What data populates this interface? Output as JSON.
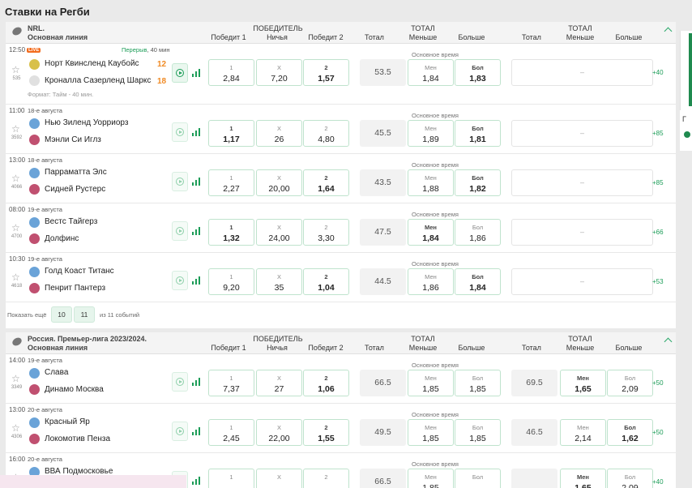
{
  "page": {
    "title": "Ставки на Регби"
  },
  "headers": {
    "winner": "ПОБЕДИТЕЛЬ",
    "win1": "Победит 1",
    "draw": "Ничья",
    "win2": "Победит 2",
    "total": "Тотал",
    "total_caps": "ТОТАЛ",
    "under": "Меньше",
    "over": "Больше",
    "main_time": "Основное время",
    "under_short": "Мен",
    "over_short": "Бол",
    "draw_short": "X",
    "one": "1",
    "two": "2",
    "dash": "–"
  },
  "nrl": {
    "league_name": "NRL.",
    "line": "Основная линия",
    "live_match": {
      "time": "12:50",
      "live_badge": "LIVE",
      "status_main": "Перерыв",
      "status_rest": ", 40 мин",
      "id": "535",
      "team1": "Норт Квинсленд Каубойс",
      "team2": "Кроналла Сазерленд Шаркс",
      "score1": "12",
      "score2": "18",
      "format": "Формат: Тайм - 40 мин.",
      "odds": [
        "2,84",
        "7,20",
        "1,57"
      ],
      "total": "53.5",
      "under": "1,84",
      "over": "1,83",
      "more": "+40"
    },
    "matches": [
      {
        "time": "11:00",
        "date": "18-е августа",
        "id": "3592",
        "team1": "Нью Зиленд Уорриорз",
        "team2": "Мэнли Си Иглз",
        "odds": [
          "1,17",
          "26",
          "4,80"
        ],
        "total": "45.5",
        "under": "1,89",
        "over": "1,81",
        "more": "+85"
      },
      {
        "time": "13:00",
        "date": "18-е августа",
        "id": "4066",
        "team1": "Парраматта Элс",
        "team2": "Сидней Рустерс",
        "odds": [
          "2,27",
          "20,00",
          "1,64"
        ],
        "total": "43.5",
        "under": "1,88",
        "over": "1,82",
        "more": "+85"
      },
      {
        "time": "08:00",
        "date": "19-е августа",
        "id": "4700",
        "team1": "Вестс Тайгерз",
        "team2": "Долфинс",
        "odds": [
          "1,32",
          "24,00",
          "3,30"
        ],
        "total": "47.5",
        "under": "1,84",
        "over": "1,86",
        "more": "+66"
      },
      {
        "time": "10:30",
        "date": "19-е августа",
        "id": "4618",
        "team1": "Голд Коаст Титанс",
        "team2": "Пенрит Пантерз",
        "odds": [
          "9,20",
          "35",
          "1,04"
        ],
        "total": "44.5",
        "under": "1,86",
        "over": "1,84",
        "more": "+53"
      }
    ],
    "show_more": {
      "label": "Показать ещё",
      "page1": "10",
      "page2": "11",
      "total": "из 11 событий"
    }
  },
  "russia": {
    "league_name": "Россия. Премьер-лига 2023/2024.",
    "line": "Основная линия",
    "matches": [
      {
        "time": "14:00",
        "date": "19-е августа",
        "id": "3349",
        "team1": "Слава",
        "team2": "Динамо Москва",
        "odds": [
          "7,37",
          "27",
          "1,06"
        ],
        "total": "66.5",
        "under": "1,85",
        "over": "1,85",
        "total2": "69.5",
        "under2": "1,65",
        "over2": "2,09",
        "more": "+50"
      },
      {
        "time": "13:00",
        "date": "20-е августа",
        "id": "4306",
        "team1": "Красный Яр",
        "team2": "Локомотив Пенза",
        "odds": [
          "2,45",
          "22,00",
          "1,55"
        ],
        "total": "49.5",
        "under": "1,85",
        "over": "1,85",
        "total2": "46.5",
        "under2": "2,14",
        "over2": "1,62",
        "more": "+50"
      },
      {
        "time": "16:00",
        "date": "20-е августа",
        "id": "",
        "team1": "ВВА Подмосковье",
        "team2": "",
        "odds": [
          "",
          "",
          ""
        ],
        "total": "66.5",
        "under": "1,85",
        "over": "",
        "total2": "",
        "under2": "1,65",
        "over2": "2,09",
        "more": "+40"
      }
    ]
  },
  "colors": {
    "accent": "#1b9c57",
    "live": "#f26b1d",
    "score": "#f08a24",
    "odd_border": "#bfe3cd"
  }
}
